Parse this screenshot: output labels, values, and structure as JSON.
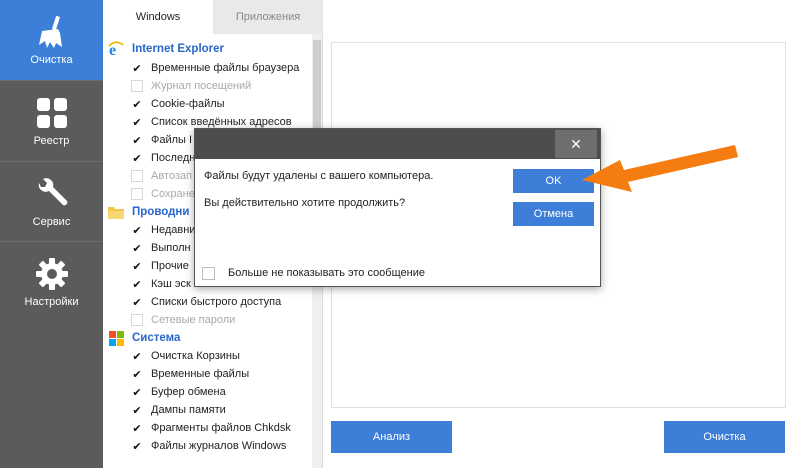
{
  "sidebar": {
    "items": [
      {
        "label": "Очистка",
        "icon": "broom-icon",
        "active": true
      },
      {
        "label": "Реестр",
        "icon": "grid-icon",
        "active": false
      },
      {
        "label": "Сервис",
        "icon": "wrench-icon",
        "active": false
      },
      {
        "label": "Настройки",
        "icon": "gear-icon",
        "active": false
      }
    ]
  },
  "tabs": [
    {
      "label": "Windows",
      "active": true
    },
    {
      "label": "Приложения",
      "active": false
    }
  ],
  "tree": {
    "sections": [
      {
        "title": "Internet Explorer",
        "icon": "internet-explorer-icon",
        "items": [
          {
            "label": "Временные файлы браузера",
            "checked": true
          },
          {
            "label": "Журнал посещений",
            "checked": false
          },
          {
            "label": "Cookie-файлы",
            "checked": true
          },
          {
            "label": "Список введённых адресов",
            "checked": true
          },
          {
            "label": "Файлы I",
            "checked": true
          },
          {
            "label": "Последн",
            "checked": true
          },
          {
            "label": "Автозап",
            "checked": false
          },
          {
            "label": "Сохране",
            "checked": false
          }
        ]
      },
      {
        "title": "Проводни",
        "icon": "folder-icon",
        "items": [
          {
            "label": "Недавни",
            "checked": true
          },
          {
            "label": "Выполн",
            "checked": true
          },
          {
            "label": "Прочие",
            "checked": true
          },
          {
            "label": "Кэш эск",
            "checked": true
          },
          {
            "label": "Списки быстрого доступа",
            "checked": true
          },
          {
            "label": "Сетевые пароли",
            "checked": false
          }
        ]
      },
      {
        "title": "Система",
        "icon": "windows-logo-icon",
        "items": [
          {
            "label": "Очистка Корзины",
            "checked": true
          },
          {
            "label": "Временные файлы",
            "checked": true
          },
          {
            "label": "Буфер обмена",
            "checked": true
          },
          {
            "label": "Дампы памяти",
            "checked": true
          },
          {
            "label": "Фрагменты файлов Chkdsk",
            "checked": true
          },
          {
            "label": "Файлы журналов Windows",
            "checked": true
          }
        ]
      }
    ]
  },
  "actions": {
    "analyze_label": "Анализ",
    "clean_label": "Очистка"
  },
  "dialog": {
    "close_glyph": "✕",
    "message_line1": "Файлы будут удалены с вашего компьютера.",
    "message_line2": "Вы действительно хотите продолжить?",
    "ok_label": "OK",
    "cancel_label": "Отмена",
    "dont_show_label": "Больше не показывать это сообщение",
    "dont_show_checked": false
  },
  "colors": {
    "accent": "#3d7fd8",
    "sidebar": "#5b5b5b",
    "arrow": "#f57c10",
    "section_title": "#2a66c9"
  }
}
